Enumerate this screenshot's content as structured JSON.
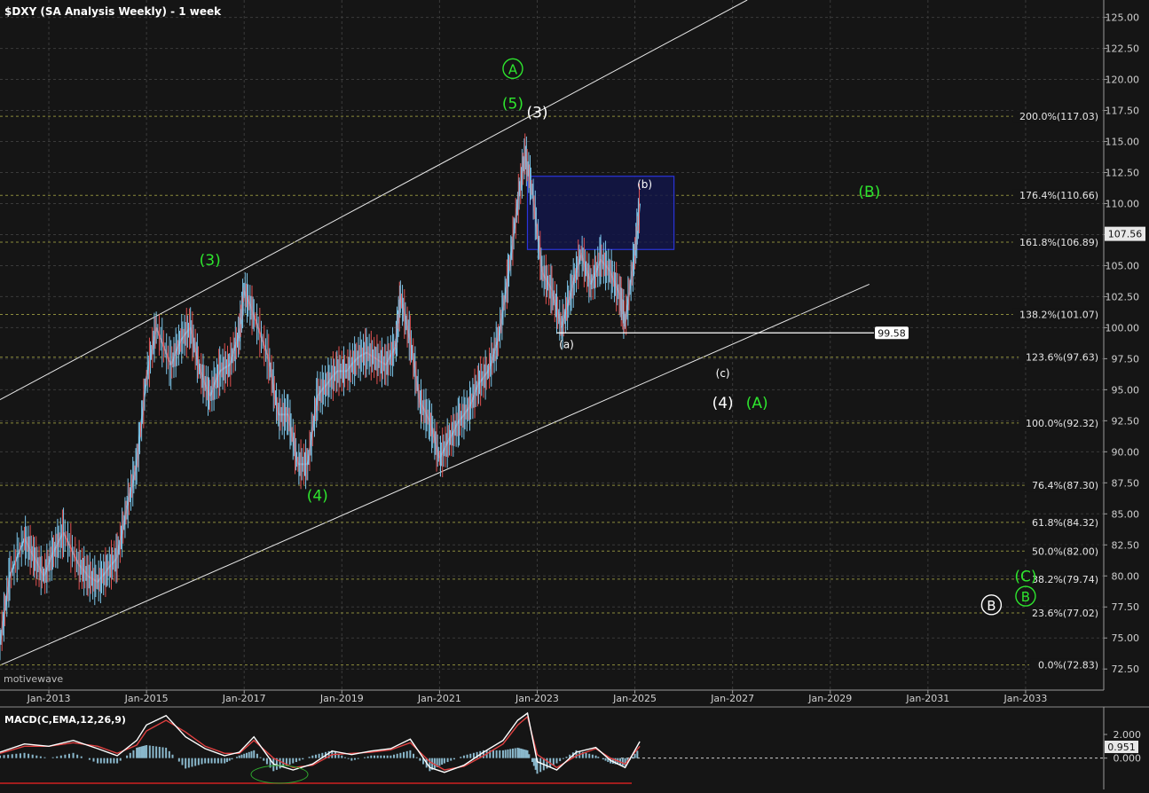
{
  "header": {
    "title": "$DXY (SA Analysis Weekly) - 1 week"
  },
  "watermark": "motivewave",
  "colors": {
    "background": "#151515",
    "grid": "#3a3a3a",
    "wave_green": "#2ee62e",
    "wave_white": "#ffffff",
    "fib_line": "#8c8c3c",
    "box_fill": "#121548",
    "box_stroke": "#2a34d8",
    "macd_line": "#ffffff",
    "signal_line": "#e04040",
    "histogram": "#8ab8cc",
    "price_up": "#7cc4e8",
    "price_down": "#e05050"
  },
  "chart_data": [
    {
      "type": "line",
      "name": "price",
      "x_axis": {
        "ticks": [
          "Jan-2013",
          "Jan-2015",
          "Jan-2017",
          "Jan-2019",
          "Jan-2021",
          "Jan-2023",
          "Jan-2025",
          "Jan-2027",
          "Jan-2029",
          "Jan-2031",
          "Jan-2033"
        ],
        "range": [
          2012.0,
          2034.6
        ]
      },
      "y_axis": {
        "ticks": [
          "72.50",
          "75.00",
          "77.50",
          "80.00",
          "82.50",
          "85.00",
          "87.50",
          "90.00",
          "92.50",
          "95.00",
          "97.50",
          "100.00",
          "102.50",
          "105.00",
          "107.50",
          "110.00",
          "112.50",
          "115.00",
          "117.50",
          "120.00",
          "122.50",
          "125.00"
        ],
        "range": [
          70.8,
          126.4
        ],
        "side": "right"
      },
      "last_price": "107.56",
      "series": [
        {
          "x": [
            2012.0,
            2012.2,
            2012.5,
            2012.7,
            2012.9,
            2013.1,
            2013.3,
            2013.6,
            2013.8,
            2014.0,
            2014.2,
            2014.4,
            2014.6,
            2014.8,
            2015.0,
            2015.2,
            2015.5,
            2015.7,
            2015.9,
            2016.1,
            2016.3,
            2016.5,
            2016.7,
            2016.9,
            2017.0,
            2017.2,
            2017.5,
            2017.7,
            2017.9,
            2018.1,
            2018.3,
            2018.5,
            2018.7,
            2018.9,
            2019.1,
            2019.3,
            2019.5,
            2019.7,
            2019.9,
            2020.1,
            2020.2,
            2020.4,
            2020.6,
            2020.8,
            2021.0,
            2021.2,
            2021.4,
            2021.6,
            2021.8,
            2022.0,
            2022.2,
            2022.4,
            2022.6,
            2022.75,
            2022.9,
            2023.1,
            2023.3,
            2023.5,
            2023.7,
            2023.9,
            2024.1,
            2024.3,
            2024.5,
            2024.7,
            2024.8,
            2025.0,
            2025.1
          ],
          "y": [
            74.5,
            80.0,
            83.0,
            81.5,
            80.0,
            82.0,
            83.5,
            81.0,
            80.0,
            79.5,
            80.5,
            81.5,
            85.5,
            89.0,
            96.0,
            100.0,
            97.0,
            99.0,
            100.0,
            96.5,
            94.5,
            96.5,
            97.0,
            99.5,
            103.0,
            101.0,
            97.5,
            93.0,
            93.0,
            89.0,
            89.0,
            94.5,
            95.5,
            96.5,
            96.5,
            97.5,
            98.0,
            97.5,
            97.0,
            98.5,
            102.5,
            99.0,
            94.0,
            92.5,
            89.5,
            91.0,
            92.5,
            93.5,
            95.5,
            96.5,
            99.0,
            104.0,
            110.0,
            114.0,
            111.0,
            104.5,
            103.0,
            100.0,
            103.0,
            106.0,
            103.5,
            105.5,
            104.5,
            102.5,
            100.5,
            106.0,
            110.0
          ]
        }
      ]
    },
    {
      "type": "line",
      "name": "MACD(C,EMA,12,26,9)",
      "y_axis": {
        "ticks": [
          "2.000",
          "0.000"
        ],
        "current": "0.951",
        "range": [
          -2.2,
          4.1
        ]
      },
      "series": [
        {
          "name": "macd",
          "x": [
            2012.0,
            2012.5,
            2013.0,
            2013.5,
            2014.0,
            2014.4,
            2014.8,
            2015.0,
            2015.4,
            2015.8,
            2016.2,
            2016.6,
            2016.9,
            2017.2,
            2017.6,
            2018.0,
            2018.4,
            2018.8,
            2019.2,
            2019.6,
            2020.0,
            2020.4,
            2020.8,
            2021.1,
            2021.5,
            2021.9,
            2022.3,
            2022.6,
            2022.8,
            2023.0,
            2023.4,
            2023.8,
            2024.2,
            2024.5,
            2024.8,
            2025.1
          ],
          "y": [
            0.5,
            1.2,
            1.0,
            1.5,
            0.8,
            0.2,
            1.5,
            2.8,
            3.6,
            1.8,
            0.8,
            0.2,
            0.5,
            1.8,
            -0.5,
            -1.0,
            -0.5,
            0.6,
            0.3,
            0.6,
            0.8,
            1.6,
            -0.8,
            -1.2,
            -0.6,
            0.5,
            1.5,
            3.2,
            3.8,
            -0.3,
            -1.0,
            0.5,
            0.9,
            -0.2,
            -0.8,
            1.4
          ]
        },
        {
          "name": "signal",
          "x": [
            2012.0,
            2012.5,
            2013.0,
            2013.5,
            2014.0,
            2014.4,
            2014.8,
            2015.0,
            2015.4,
            2015.8,
            2016.2,
            2016.6,
            2016.9,
            2017.2,
            2017.6,
            2018.0,
            2018.4,
            2018.8,
            2019.2,
            2019.6,
            2020.0,
            2020.4,
            2020.8,
            2021.1,
            2021.5,
            2021.9,
            2022.3,
            2022.6,
            2022.8,
            2023.0,
            2023.4,
            2023.8,
            2024.2,
            2024.5,
            2024.8,
            2025.1
          ],
          "y": [
            0.4,
            1.0,
            1.0,
            1.3,
            1.0,
            0.4,
            1.1,
            2.3,
            3.2,
            2.2,
            1.0,
            0.4,
            0.4,
            1.5,
            0.0,
            -0.8,
            -0.6,
            0.3,
            0.4,
            0.5,
            0.7,
            1.3,
            -0.3,
            -1.0,
            -0.7,
            0.2,
            1.2,
            2.8,
            3.5,
            0.3,
            -0.8,
            0.2,
            0.8,
            0.0,
            -0.5,
            1.0
          ]
        }
      ]
    }
  ],
  "fib_levels": [
    {
      "label": "200.0%(117.03)",
      "value": 117.03
    },
    {
      "label": "176.4%(110.66)",
      "value": 110.66
    },
    {
      "label": "161.8%(106.89)",
      "value": 106.89
    },
    {
      "label": "138.2%(101.07)",
      "value": 101.07
    },
    {
      "label": "123.6%(97.63)",
      "value": 97.63
    },
    {
      "label": "100.0%(92.32)",
      "value": 92.32
    },
    {
      "label": "76.4%(87.30)",
      "value": 87.3
    },
    {
      "label": "61.8%(84.32)",
      "value": 84.32
    },
    {
      "label": "50.0%(82.00)",
      "value": 82.0
    },
    {
      "label": "38.2%(79.74)",
      "value": 79.74
    },
    {
      "label": "23.6%(77.02)",
      "value": 77.02
    },
    {
      "label": "0.0%(72.83)",
      "value": 72.83
    }
  ],
  "support_line": {
    "value": 99.58,
    "label": "99.58",
    "x_start": 2023.4
  },
  "box_zone": {
    "x_start": 2022.8,
    "x_end": 2025.8,
    "y_low": 106.3,
    "y_high": 112.2
  },
  "channel": {
    "upper": [
      {
        "x": 2012.0,
        "y": 94.2
      },
      {
        "x": 2027.3,
        "y": 126.4
      }
    ],
    "lower": [
      {
        "x": 2012.0,
        "y": 72.8
      },
      {
        "x": 2029.8,
        "y": 103.5
      }
    ]
  },
  "wave_labels": [
    {
      "text": "A",
      "x": 2022.5,
      "y": 120.8,
      "color": "green",
      "circled": true
    },
    {
      "text": "(5)",
      "x": 2022.5,
      "y": 118.0,
      "color": "green"
    },
    {
      "text": "(3)",
      "x": 2023.0,
      "y": 117.3,
      "color": "white"
    },
    {
      "text": "(3)",
      "x": 2016.3,
      "y": 105.4,
      "color": "green"
    },
    {
      "text": "(4)",
      "x": 2018.5,
      "y": 86.4,
      "color": "green"
    },
    {
      "text": "(b)",
      "x": 2025.2,
      "y": 111.6,
      "color": "white",
      "small": true
    },
    {
      "text": "(a)",
      "x": 2023.6,
      "y": 98.7,
      "color": "white",
      "small": true
    },
    {
      "text": "(c)",
      "x": 2026.8,
      "y": 96.4,
      "color": "white",
      "small": true
    },
    {
      "text": "(B)",
      "x": 2029.8,
      "y": 110.9,
      "color": "green"
    },
    {
      "text": "(4)",
      "x": 2026.8,
      "y": 93.9,
      "color": "white"
    },
    {
      "text": "(A)",
      "x": 2027.5,
      "y": 93.9,
      "color": "green"
    },
    {
      "text": "(C)",
      "x": 2033.0,
      "y": 79.9,
      "color": "green"
    },
    {
      "text": "B",
      "x": 2033.0,
      "y": 78.3,
      "color": "green",
      "circled": true
    },
    {
      "text": "B",
      "x": 2032.3,
      "y": 77.6,
      "color": "white",
      "circled": true
    }
  ]
}
